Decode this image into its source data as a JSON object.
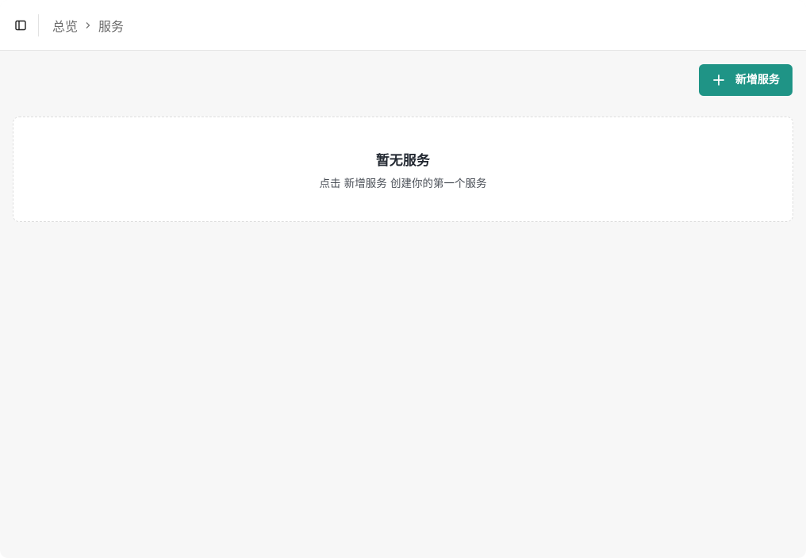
{
  "header": {
    "sidebar_toggle_icon": "sidebar-panel-icon",
    "breadcrumb": {
      "items": [
        {
          "label": "总览"
        }
      ],
      "separator_icon": "chevron-right-icon",
      "current": "服务"
    }
  },
  "toolbar": {
    "add_button_label": "新增服务",
    "add_button_icon": "plus-icon",
    "accent_color": "#1f9486"
  },
  "empty_state": {
    "title": "暂无服务",
    "description": "点击 新增服务 创建你的第一个服务"
  }
}
